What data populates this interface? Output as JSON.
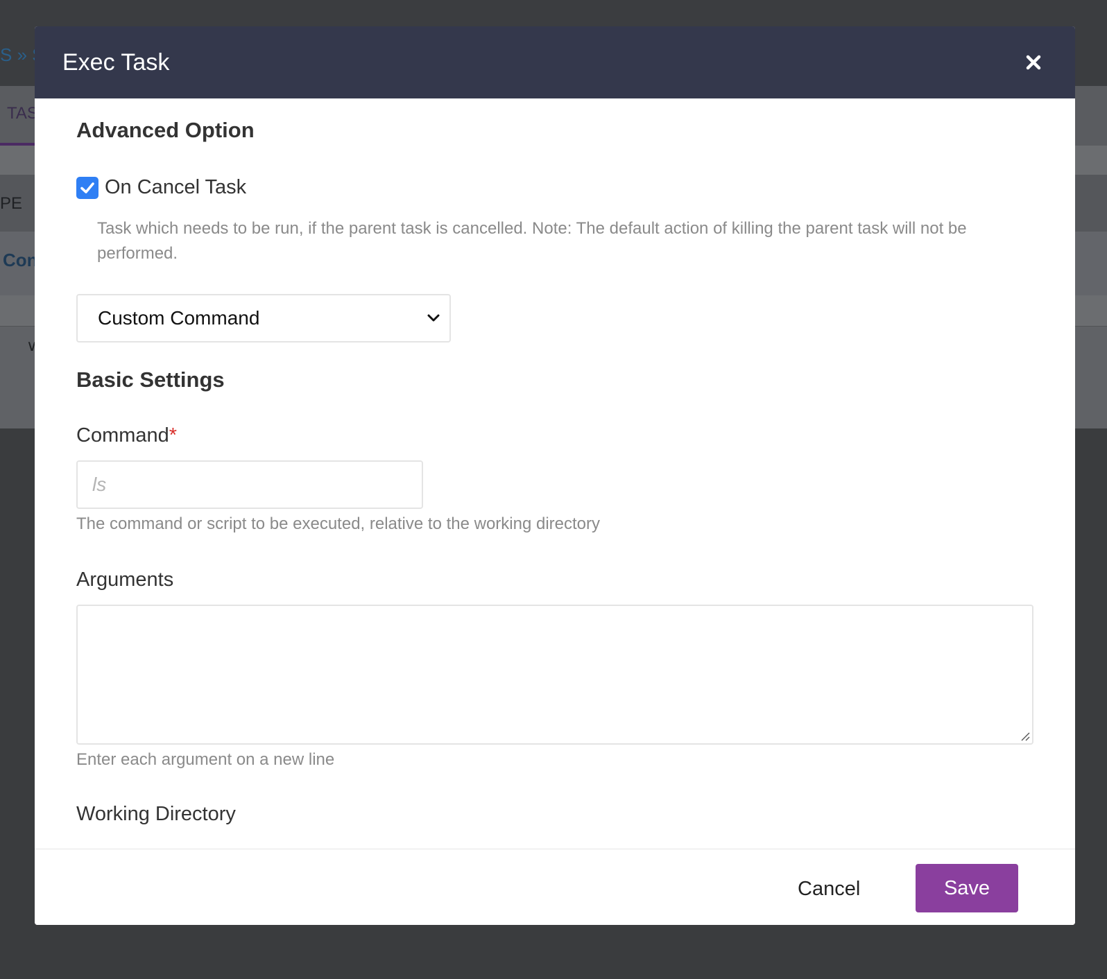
{
  "background": {
    "breadcrumb": "S » S",
    "tab": "TAS",
    "row_type": "PE",
    "row_con": "Con"
  },
  "modal": {
    "title": "Exec Task",
    "close_icon": "close-icon",
    "advanced_section": {
      "title": "Advanced Option",
      "on_cancel_checkbox": {
        "label": "On Cancel Task",
        "checked": true
      },
      "help": "Task which needs to be run, if the parent task is cancelled. Note: The default action of killing the parent task will not be performed.",
      "select": {
        "value": "Custom Command"
      }
    },
    "basic_section": {
      "title": "Basic Settings",
      "command": {
        "label": "Command",
        "required_mark": "*",
        "placeholder": "ls",
        "value": "",
        "help": "The command or script to be executed, relative to the working directory"
      },
      "arguments": {
        "label": "Arguments",
        "value": "",
        "help": "Enter each argument on a new line"
      },
      "working_directory": {
        "label": "Working Directory"
      }
    },
    "footer": {
      "cancel_label": "Cancel",
      "save_label": "Save"
    },
    "colors": {
      "header_bg": "#34384c",
      "accent": "#8a3f9e",
      "checkbox": "#2f7ff4",
      "required": "#d9302c"
    }
  }
}
